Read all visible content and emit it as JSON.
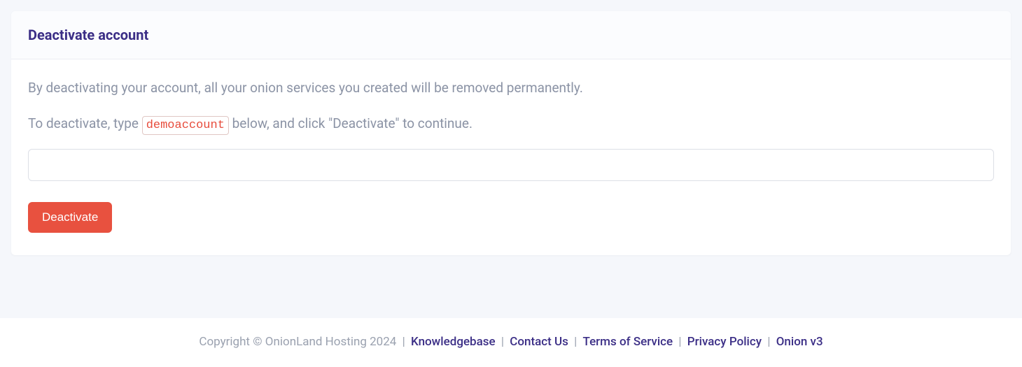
{
  "card": {
    "title": "Deactivate account",
    "description": "By deactivating your account, all your onion services you created will be removed permanently.",
    "instruction_prefix": "To deactivate, type ",
    "account_code": "demoaccount",
    "instruction_suffix": " below, and click \"Deactivate\" to continue.",
    "input_value": "",
    "button_label": "Deactivate"
  },
  "footer": {
    "copyright": "Copyright © OnionLand Hosting 2024",
    "links": {
      "knowledgebase": "Knowledgebase",
      "contact": "Contact Us",
      "terms": "Terms of Service",
      "privacy": "Privacy Policy",
      "onion": "Onion v3"
    },
    "separator": " | "
  }
}
